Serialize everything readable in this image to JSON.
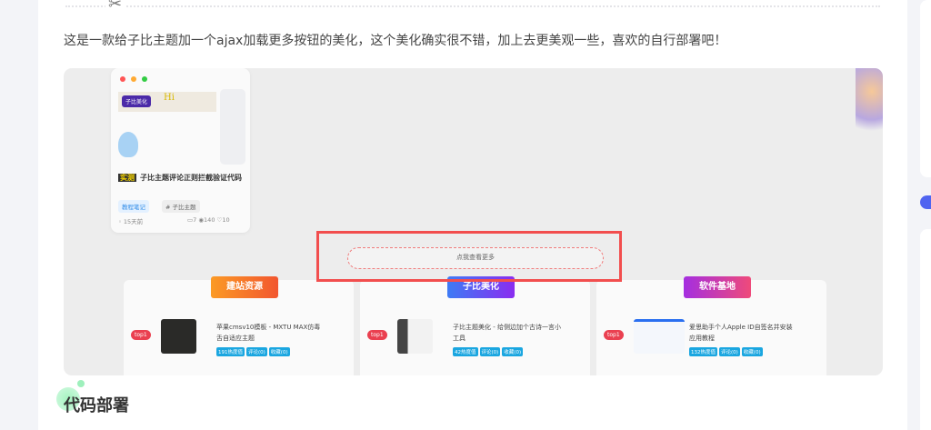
{
  "article": {
    "intro": "这是一款给子比主题加一个ajax加载更多按钮的美化，这个美化确实很不错，加上去更美观一些，喜欢的自行部署吧！",
    "divider_icon": "scissors-icon",
    "section_heading": "代码部署"
  },
  "screenshot": {
    "post_card": {
      "banner_tag": "子比美化",
      "banner_hi": "Hi",
      "badge": "实测",
      "title": "子比主题评论正则拦截验证代码",
      "category": "教程笔记",
      "tag": "# 子比主题",
      "time": "15天前",
      "comments": "7",
      "views": "140",
      "likes": "10"
    },
    "load_more_label": "点我查看更多",
    "columns": [
      {
        "ribbon": "建站资源",
        "rank": "top1",
        "title": "苹果cmsv10模板 - MXTU MAX仿毒舌自适应主题",
        "heat": "191热度值",
        "comments": "评论(0)",
        "favorites": "收藏(0)",
        "color": "#f36a2a"
      },
      {
        "ribbon": "子比美化",
        "rank": "top1",
        "title": "子比主题美化 - 给侧边加个古诗一言小工具",
        "heat": "42热度值",
        "comments": "评论(0)",
        "favorites": "收藏(0)",
        "color": "#5a4cf0"
      },
      {
        "ribbon": "软件基地",
        "rank": "top1",
        "title": "爱思助手个人Apple ID自签名并安装应用教程",
        "heat": "132热度值",
        "comments": "评论(0)",
        "favorites": "收藏(0)",
        "color": "#c53ad0"
      }
    ]
  },
  "highlight_color": "#f24e4e"
}
